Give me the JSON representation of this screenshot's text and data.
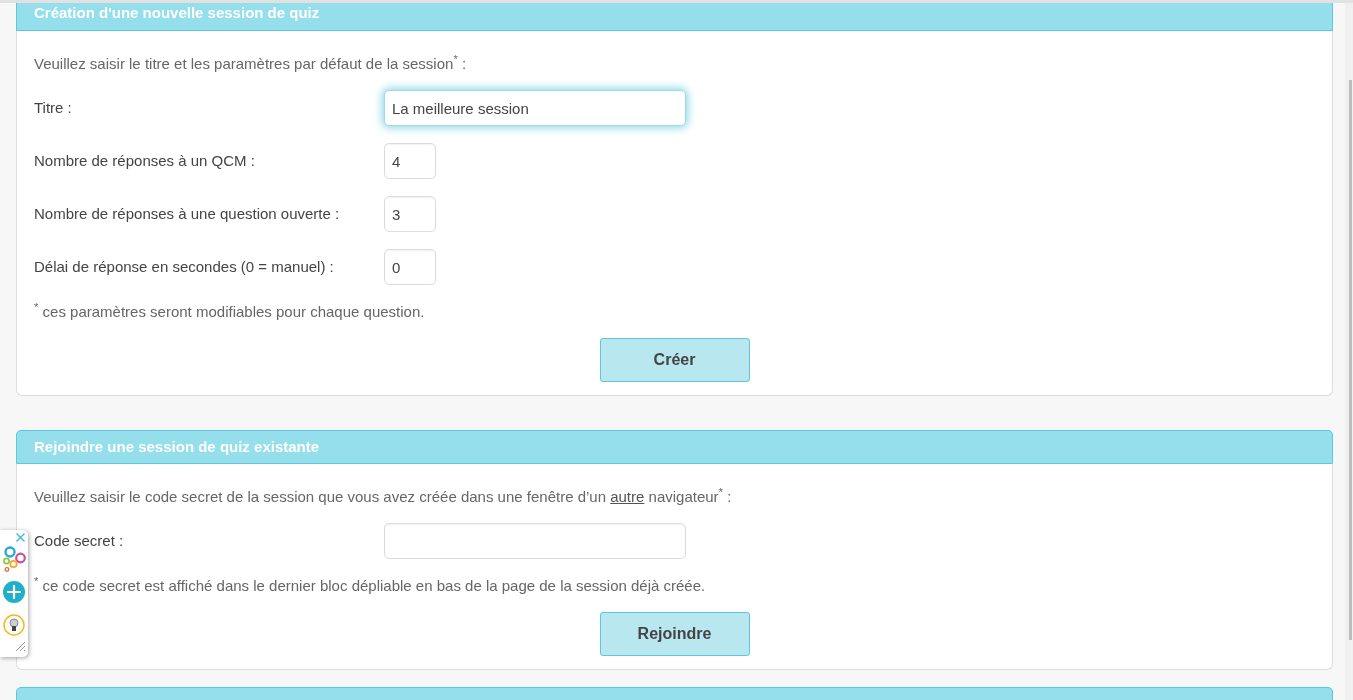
{
  "sections": [
    {
      "title": "Création d'une nouvelle session de quiz",
      "intro": [
        {
          "kind": "text",
          "text": "Veuillez saisir le titre et les paramètres par défaut de la session$^{*}$ :"
        }
      ],
      "fields": [
        {
          "label": "Titre :",
          "kind": "text",
          "value": "La meilleure session",
          "focused": true
        },
        {
          "label": "Nombre de réponses à un QCM :",
          "kind": "number",
          "value": "4",
          "focused": false
        },
        {
          "label": "Nombre de réponses à une question ouverte :",
          "kind": "number",
          "value": "3",
          "focused": false
        },
        {
          "label": "Délai de réponse en secondes (0 = manuel) :",
          "kind": "number",
          "value": "0",
          "focused": false
        }
      ],
      "note": "$^{*}$ ces paramètres seront modifiables pour chaque question.",
      "button": "Créer"
    },
    {
      "title": "Rejoindre une session de quiz existante",
      "intro": [
        {
          "kind": "text",
          "text": "Veuillez saisir le code secret de la session que vous avez créée dans une fenêtre d’un "
        },
        {
          "kind": "link",
          "text": "autre"
        },
        {
          "kind": "text",
          "text": " navigateur$^{*}$ :"
        }
      ],
      "fields": [
        {
          "label": "Code secret :",
          "kind": "text",
          "focused": false
        }
      ],
      "note": "$^{*}$ ce code secret est affiché dans le dernier bloc dépliable en bas de la page de la session déjà créée.",
      "button": "Rejoindre"
    }
  ]
}
